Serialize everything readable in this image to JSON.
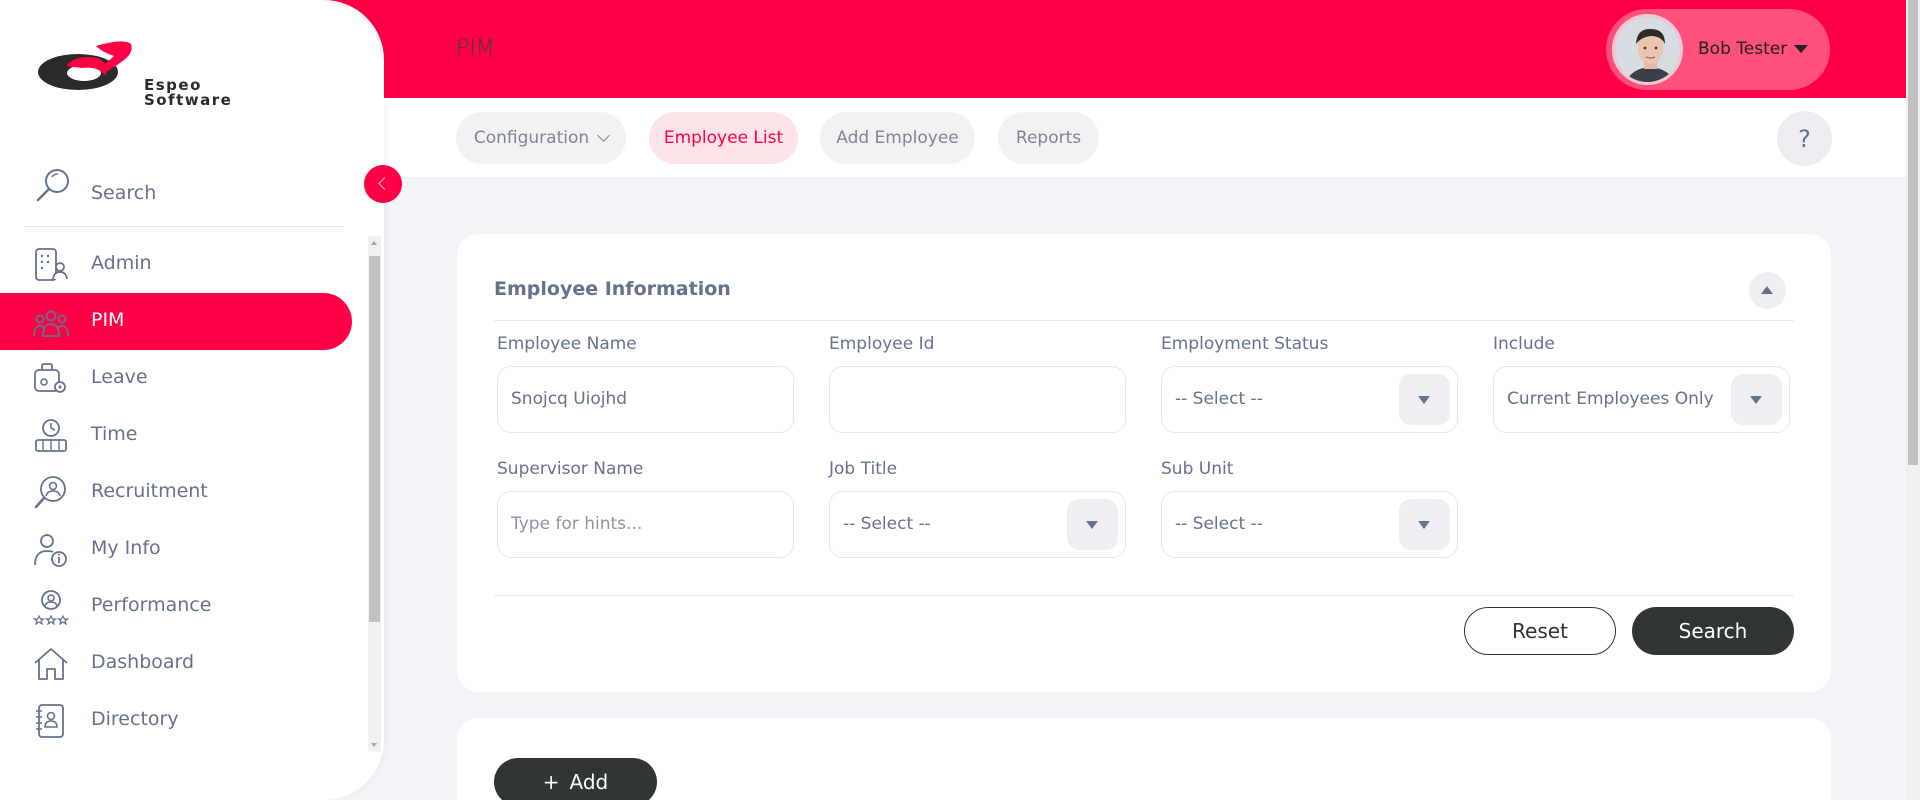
{
  "header": {
    "module_title": "PIM",
    "user_name": "Bob Tester",
    "brand_color": "#ff0046"
  },
  "subnav": {
    "tabs": [
      {
        "label": "Configuration",
        "has_dropdown": true,
        "active": false
      },
      {
        "label": "Employee List",
        "active": true
      },
      {
        "label": "Add Employee",
        "active": false
      },
      {
        "label": "Reports",
        "active": false
      }
    ],
    "help_label": "?"
  },
  "sidebar": {
    "logo_line1": "Espeo",
    "logo_line2": "Software",
    "search_label": "Search",
    "items": [
      {
        "label": "Admin",
        "icon": "admin-icon",
        "active": false
      },
      {
        "label": "PIM",
        "icon": "pim-icon",
        "active": true
      },
      {
        "label": "Leave",
        "icon": "leave-icon",
        "active": false
      },
      {
        "label": "Time",
        "icon": "time-icon",
        "active": false
      },
      {
        "label": "Recruitment",
        "icon": "recruitment-icon",
        "active": false
      },
      {
        "label": "My Info",
        "icon": "my-info-icon",
        "active": false
      },
      {
        "label": "Performance",
        "icon": "performance-icon",
        "active": false
      },
      {
        "label": "Dashboard",
        "icon": "dashboard-icon",
        "active": false
      },
      {
        "label": "Directory",
        "icon": "directory-icon",
        "active": false
      }
    ]
  },
  "filter": {
    "title": "Employee Information",
    "employee_name": {
      "label": "Employee Name",
      "value": "Snojcq Uiojhd"
    },
    "employee_id": {
      "label": "Employee Id",
      "value": ""
    },
    "employment_status": {
      "label": "Employment Status",
      "value": "-- Select --"
    },
    "include": {
      "label": "Include",
      "value": "Current Employees Only"
    },
    "supervisor_name": {
      "label": "Supervisor Name",
      "placeholder": "Type for hints..."
    },
    "job_title": {
      "label": "Job Title",
      "value": "-- Select --"
    },
    "sub_unit": {
      "label": "Sub Unit",
      "value": "-- Select --"
    },
    "reset_label": "Reset",
    "search_label": "Search"
  },
  "list": {
    "add_label": "Add",
    "add_icon": "plus-icon"
  }
}
